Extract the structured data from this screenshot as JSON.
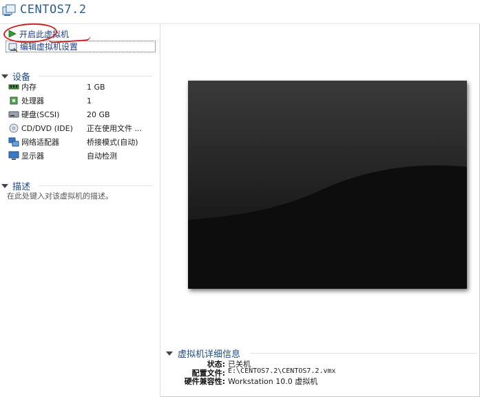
{
  "window": {
    "title": "CENTOS7.2"
  },
  "actions": {
    "power_on": "开启此虚拟机",
    "edit_settings": "编辑虚拟机设置"
  },
  "devices": {
    "header": "设备",
    "items": [
      {
        "name": "内存",
        "value": "1 GB",
        "icon": "memory-icon"
      },
      {
        "name": "处理器",
        "value": "1",
        "icon": "processor-icon"
      },
      {
        "name": "硬盘(SCSI)",
        "value": "20 GB",
        "icon": "hard-disk-icon"
      },
      {
        "name": "CD/DVD (IDE)",
        "value": "正在使用文件 ...",
        "icon": "cd-dvd-icon"
      },
      {
        "name": "网络适配器",
        "value": "桥接模式(自动)",
        "icon": "network-adapter-icon"
      },
      {
        "name": "显示器",
        "value": "自动检测",
        "icon": "display-icon"
      }
    ]
  },
  "description": {
    "header": "描述",
    "placeholder": "在此处键入对该虚拟机的描述。"
  },
  "details": {
    "header": "虚拟机详细信息",
    "rows": [
      {
        "label": "状态:",
        "value": "已关机"
      },
      {
        "label": "配置文件:",
        "value": "E:\\CENTOS7.2\\CENTOS7.2.vmx"
      },
      {
        "label": "硬件兼容性:",
        "value": "Workstation 10.0 虚拟机"
      }
    ]
  },
  "colors": {
    "title": "#2a5d95",
    "link": "#1f3f8a",
    "section_header": "#1e4a86",
    "annotation": "#cc2222",
    "preview_bg": "#0d0d0d"
  }
}
